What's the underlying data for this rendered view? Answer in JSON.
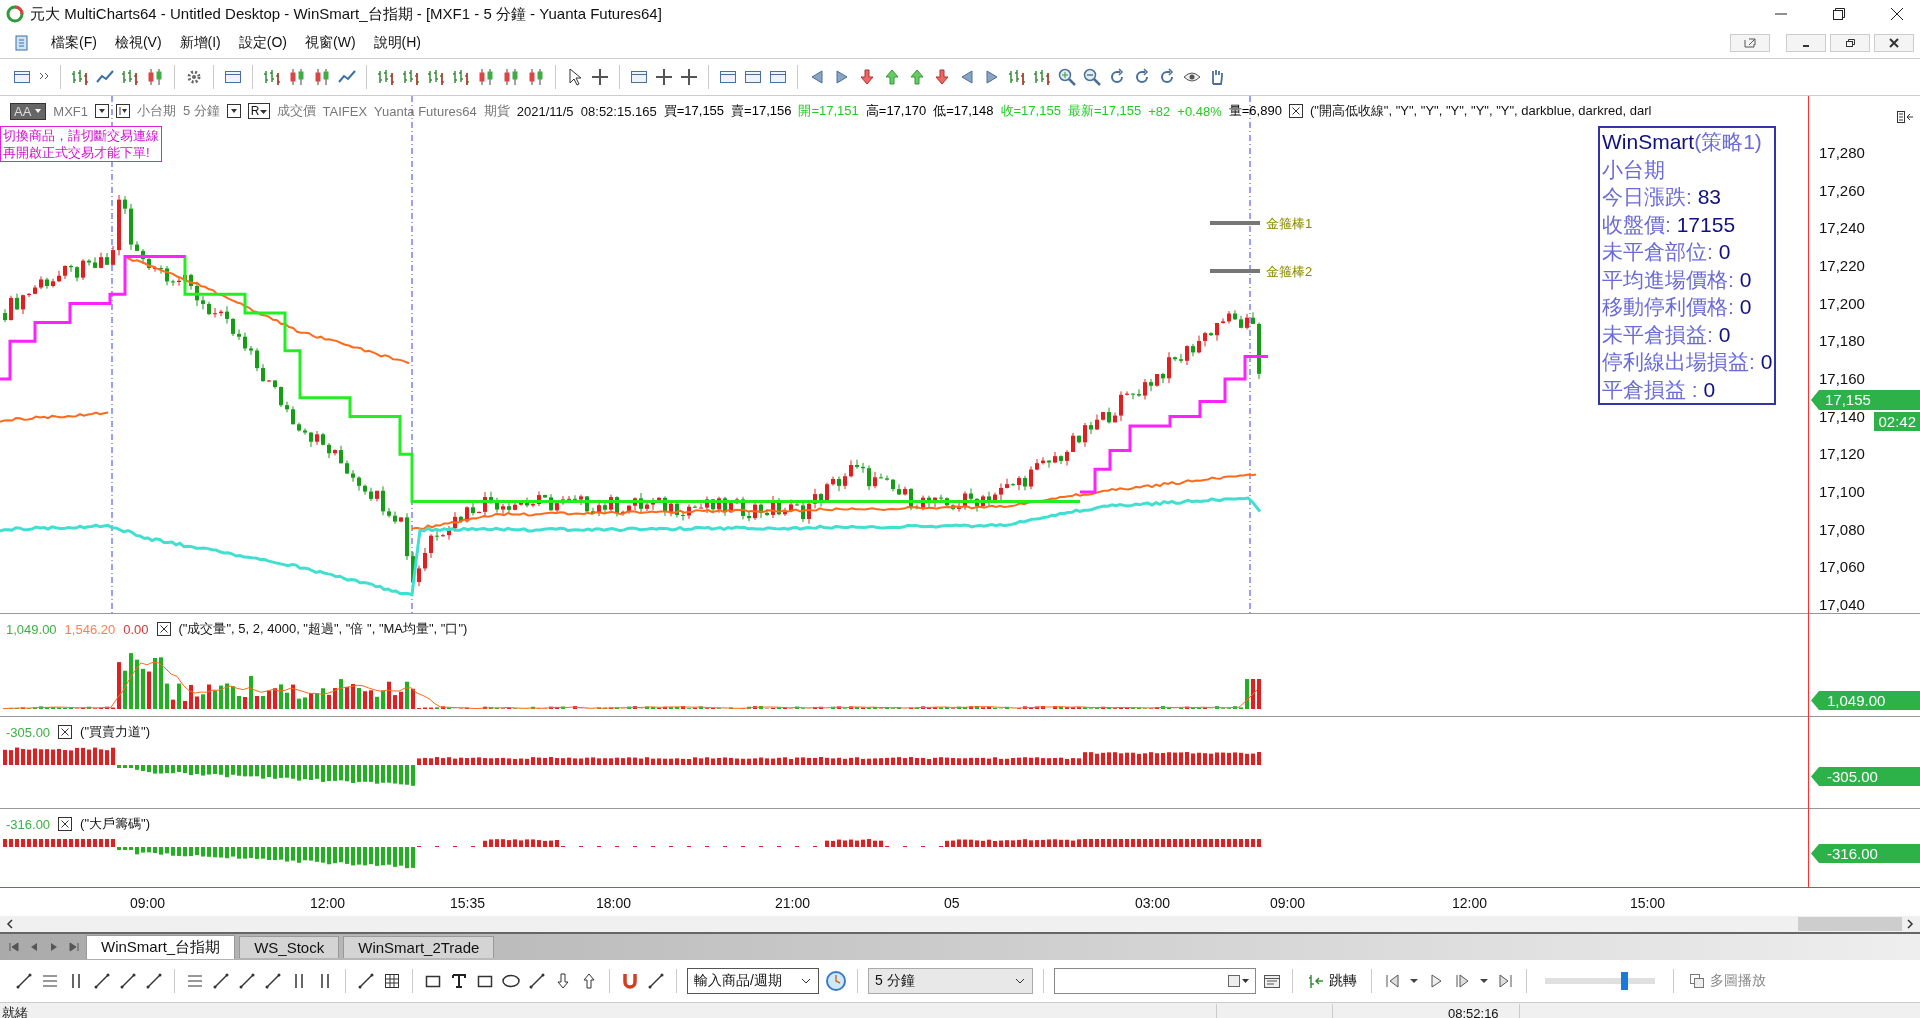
{
  "window": {
    "title": "元大 MultiCharts64 - Untitled Desktop - WinSmart_台指期 - [MXF1 - 5 分鐘 - Yuanta Futures64]"
  },
  "menu": [
    "檔案(F)",
    "檢視(V)",
    "新增(I)",
    "設定(O)",
    "視窗(W)",
    "說明(H)"
  ],
  "symbol_bar": {
    "style_button": "AA",
    "symbol": "MXF1",
    "name": "小台期",
    "interval": "5 分鐘",
    "price_type_button": "R",
    "price_type": "成交價",
    "exchange": "TAIFEX",
    "feed": "Yuanta Futures64",
    "category": "期貨",
    "datetime": "2021/11/5  08:52:15.165",
    "quotes": [
      {
        "text": "買=17,155",
        "color": "#000000"
      },
      {
        "text": "賣=17,156",
        "color": "#000000"
      },
      {
        "text": "開=17,151",
        "color": "#22cc22"
      },
      {
        "text": "高=17,170",
        "color": "#000000"
      },
      {
        "text": "低=17,148",
        "color": "#000000"
      },
      {
        "text": "收=17,155",
        "color": "#22cc22"
      },
      {
        "text": "最新=17,155",
        "color": "#22cc22"
      },
      {
        "text": "+82",
        "color": "#22cc22"
      },
      {
        "text": "+0.48%",
        "color": "#22cc22"
      },
      {
        "text": "量=6,890",
        "color": "#000000"
      }
    ],
    "study": "(\"開高低收線\", \"Y\", \"Y\", \"Y\", \"Y\", \"Y\", darkblue, darkred, darl"
  },
  "warning": [
    "切換商品，請切斷交易連線",
    "再開啟正式交易才能下單!"
  ],
  "markers": [
    {
      "label": "金箍棒1"
    },
    {
      "label": "金箍棒2"
    }
  ],
  "info_box": {
    "title": "WinSmart",
    "title_suffix": "(策略1)",
    "subtitle": "小台期",
    "lines": [
      {
        "label": "今日漲跌:",
        "value": "83"
      },
      {
        "label": "收盤價:",
        "value": "17155"
      },
      {
        "label": "未平倉部位:",
        "value": "0"
      },
      {
        "label": "平均進場價格:",
        "value": "0"
      },
      {
        "label": "移動停利價格:",
        "value": "0"
      },
      {
        "label": "未平倉損益:",
        "value": "0"
      },
      {
        "label": "停利線出場損益:",
        "value": "0"
      },
      {
        "label": "平倉損益 :",
        "value": "0"
      }
    ]
  },
  "price_axis": {
    "ticks": [
      "17,280",
      "17,260",
      "17,240",
      "17,220",
      "17,200",
      "17,180",
      "17,160",
      "17,140",
      "17,120",
      "17,100",
      "17,080",
      "17,060",
      "17,040"
    ],
    "last_price": "17,155",
    "countdown": "02:42"
  },
  "panels": [
    {
      "readings": [
        {
          "text": "1,049.00",
          "color": "#3cb043"
        },
        {
          "text": "1,546.20",
          "color": "#ff7f50"
        },
        {
          "text": "0.00",
          "color": "#d03a3a"
        }
      ],
      "study": "(\"成交量\", 5, 2, 4000, \"超過\", \"倍 \", \"MA均量\", \"口\")",
      "axis_tag": "1,049.00"
    },
    {
      "readings": [
        {
          "text": "-305.00",
          "color": "#3cb043"
        }
      ],
      "study": "(\"買賣力道\")",
      "axis_tag": "-305.00"
    },
    {
      "readings": [
        {
          "text": "-316.00",
          "color": "#3cb043"
        }
      ],
      "study": "(\"大戶籌碼\")",
      "axis_tag": "-316.00"
    }
  ],
  "time_axis": [
    "09:00",
    "12:00",
    "15:35",
    "18:00",
    "21:00",
    "05",
    "03:00",
    "09:00",
    "12:00",
    "15:00"
  ],
  "sheet_tabs": [
    {
      "label": "WinSmart_台指期",
      "selected": true
    },
    {
      "label": "WS_Stock",
      "selected": false
    },
    {
      "label": "WinSmart_2Trade",
      "selected": false
    }
  ],
  "drawing_bar": {
    "symbol_select": "輸入商品/週期",
    "interval_select": "5 分鐘",
    "jump_button": "跳轉",
    "playback_button": "多圖播放",
    "speed": {
      "level": 0.72
    }
  },
  "status_bar": {
    "text": "就緒",
    "time": "08:52:16"
  }
}
